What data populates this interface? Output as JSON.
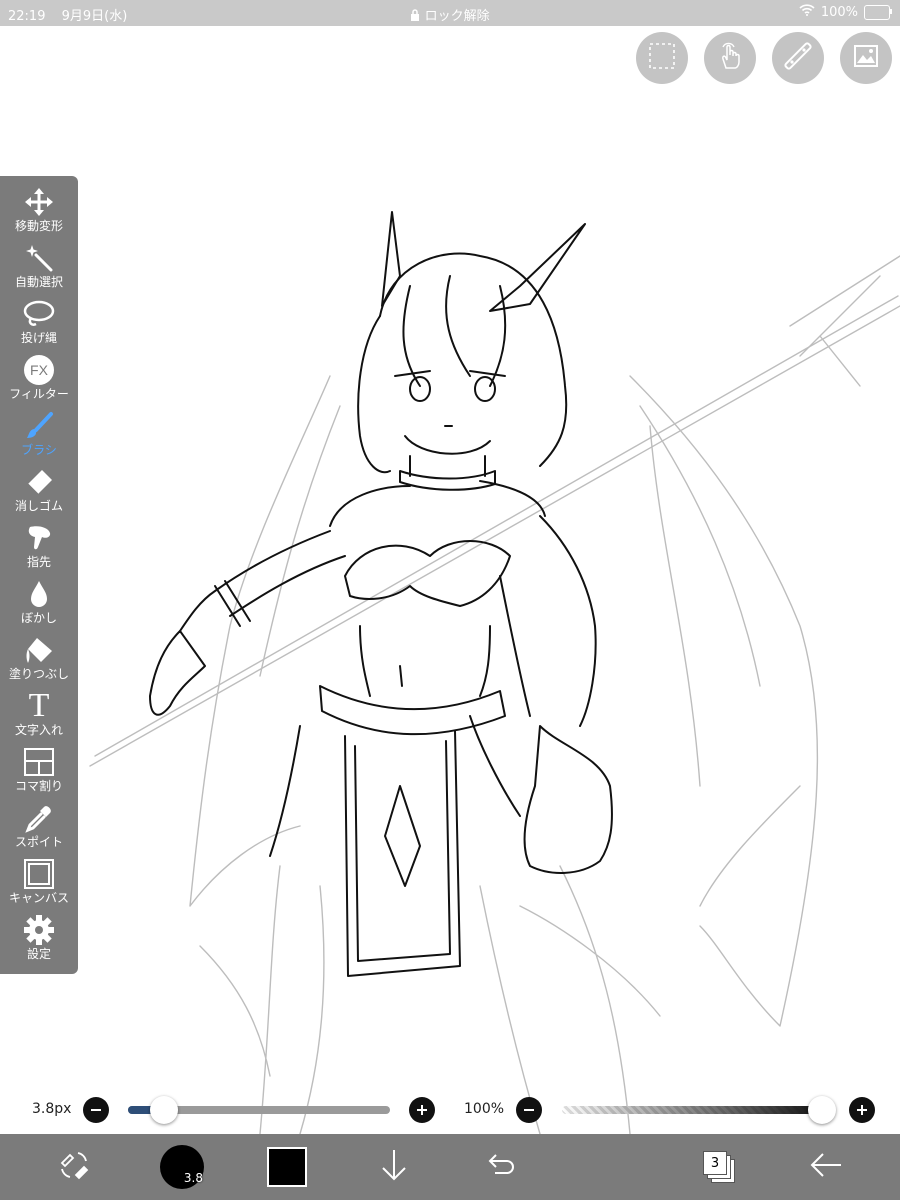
{
  "status_bar": {
    "time": "22:19",
    "date": "9月9日(水)",
    "lock_text": "ロック解除",
    "battery": "100%"
  },
  "top_tools": [
    {
      "name": "selection-icon"
    },
    {
      "name": "hand-touch-icon"
    },
    {
      "name": "ruler-icon"
    },
    {
      "name": "image-icon"
    }
  ],
  "toolbar": {
    "items": [
      {
        "label": "移動変形",
        "icon": "move-arrows-icon"
      },
      {
        "label": "自動選択",
        "icon": "magic-wand-icon"
      },
      {
        "label": "投げ縄",
        "icon": "lasso-icon"
      },
      {
        "label": "フィルター",
        "icon": "fx-icon",
        "glyph": "FX"
      },
      {
        "label": "ブラシ",
        "icon": "brush-icon",
        "active": true
      },
      {
        "label": "消しゴム",
        "icon": "eraser-icon"
      },
      {
        "label": "指先",
        "icon": "finger-smudge-icon"
      },
      {
        "label": "ぼかし",
        "icon": "blur-drop-icon"
      },
      {
        "label": "塗りつぶし",
        "icon": "fill-bucket-icon"
      },
      {
        "label": "文字入れ",
        "icon": "text-icon",
        "glyph": "T"
      },
      {
        "label": "コマ割り",
        "icon": "panel-split-icon"
      },
      {
        "label": "スポイト",
        "icon": "eyedropper-icon"
      },
      {
        "label": "キャンバス",
        "icon": "canvas-icon"
      },
      {
        "label": "設定",
        "icon": "gear-icon"
      }
    ],
    "active_color": "#4ea4ff"
  },
  "brush_size": {
    "value_label": "3.8px",
    "slider_fraction": 0.13
  },
  "opacity": {
    "value_label": "100%",
    "slider_fraction": 1.0
  },
  "bottom_bar": {
    "brush_size_badge": "3.8",
    "current_color": "#000000",
    "layer_count": "3"
  }
}
